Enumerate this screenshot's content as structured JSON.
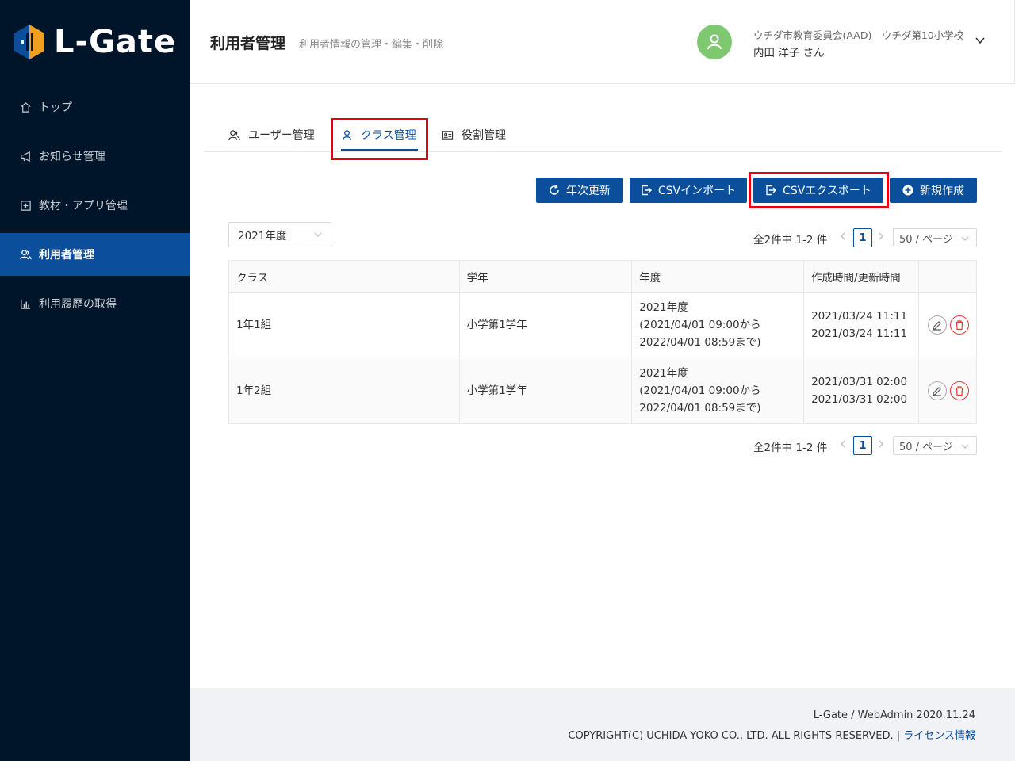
{
  "brand": {
    "name": "L-Gate"
  },
  "sidebar": {
    "items": [
      {
        "label": "トップ",
        "icon": "home-icon"
      },
      {
        "label": "お知らせ管理",
        "icon": "megaphone-icon"
      },
      {
        "label": "教材・アプリ管理",
        "icon": "plus-square-icon"
      },
      {
        "label": "利用者管理",
        "icon": "users-icon",
        "active": true
      },
      {
        "label": "利用履歴の取得",
        "icon": "bar-chart-icon"
      }
    ]
  },
  "header": {
    "title": "利用者管理",
    "subtitle": "利用者情報の管理・編集・削除",
    "org": "ウチダ市教育委員会(AAD)　ウチダ第10小学校",
    "user_name": "内田 洋子 さん"
  },
  "tabs": [
    {
      "label": "ユーザー管理",
      "icon": "users-icon"
    },
    {
      "label": "クラス管理",
      "icon": "user-icon",
      "active": true
    },
    {
      "label": "役割管理",
      "icon": "id-card-icon"
    }
  ],
  "actions": {
    "annual_update": "年次更新",
    "csv_import": "CSVインポート",
    "csv_export": "CSVエクスポート",
    "create_new": "新規作成"
  },
  "filter": {
    "year": "2021年度"
  },
  "pagination": {
    "total_text": "全2件中 1-2 件",
    "current_page": "1",
    "page_size": "50 / ページ"
  },
  "table": {
    "columns": [
      "クラス",
      "学年",
      "年度",
      "作成時間/更新時間",
      ""
    ],
    "rows": [
      {
        "class": "1年1組",
        "grade": "小学第1学年",
        "year": "2021年度",
        "year_start": "(2021/04/01 09:00から",
        "year_end": "2022/04/01 08:59まで)",
        "created": "2021/03/24 11:11",
        "updated": "2021/03/24 11:11"
      },
      {
        "class": "1年2組",
        "grade": "小学第1学年",
        "year": "2021年度",
        "year_start": "(2021/04/01 09:00から",
        "year_end": "2022/04/01 08:59まで)",
        "created": "2021/03/31 02:00",
        "updated": "2021/03/31 02:00"
      }
    ]
  },
  "footer": {
    "version": "L-Gate / WebAdmin 2020.11.24",
    "copyright": "COPYRIGHT(C) UCHIDA YOKO CO., LTD. ALL RIGHTS RESERVED. | ",
    "license_link": "ライセンス情報"
  },
  "colors": {
    "sidebar_bg": "#001529",
    "primary": "#0b4f9c",
    "highlight": "#e60012",
    "avatar": "#7ec870",
    "delete": "#e53935"
  }
}
